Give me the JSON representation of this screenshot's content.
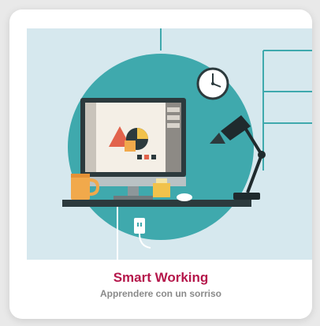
{
  "card": {
    "title": "Smart Working",
    "subtitle": "Apprendere con un sorriso"
  },
  "illustration": {
    "alt": "smart-working-desk-illustration",
    "icons": [
      "monitor-icon",
      "clock-icon",
      "desk-lamp-icon",
      "coffee-mug-icon",
      "power-outlet-icon",
      "computer-mouse-icon"
    ]
  },
  "colors": {
    "title": "#b5174b",
    "subtitle": "#8a8a8a",
    "teal_circle": "#3fa9ad",
    "background_light": "#cfe3ea"
  }
}
